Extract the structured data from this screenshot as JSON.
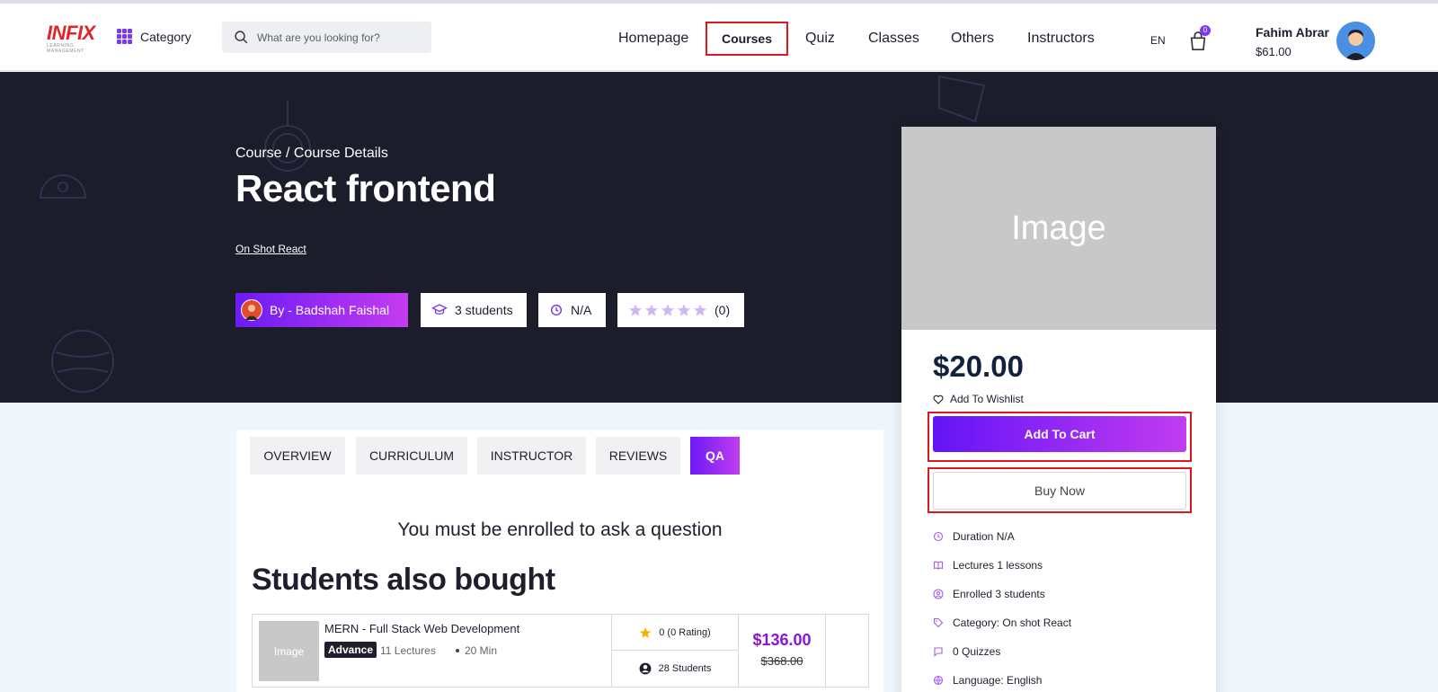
{
  "header": {
    "logo_text": "INFIX",
    "logo_sub": "LEARNING MANAGEMENT",
    "category_label": "Category",
    "search_placeholder": "What are you looking for?",
    "nav": [
      {
        "label": "Homepage"
      },
      {
        "label": "Courses"
      },
      {
        "label": "Quiz"
      },
      {
        "label": "Classes"
      },
      {
        "label": "Others"
      },
      {
        "label": "Instructors"
      }
    ],
    "language": "EN",
    "cart_count": "0",
    "user_name": "Fahim Abrar",
    "user_balance": "$61.00"
  },
  "hero": {
    "breadcrumb": "Course / Course Details",
    "title": "React frontend",
    "category_link": "On Shot React",
    "instructor": "By - Badshah Faishal",
    "students": "3 students",
    "duration": "N/A",
    "rating_count": "(0)",
    "rating_stars": 0
  },
  "card": {
    "image_placeholder": "Image",
    "price": "$20.00",
    "wishlist": "Add To Wishlist",
    "add_to_cart": "Add To Cart",
    "buy_now": "Buy Now",
    "meta": [
      {
        "icon": "clock-icon",
        "text": "Duration N/A"
      },
      {
        "icon": "book-icon",
        "text": "Lectures 1 lessons"
      },
      {
        "icon": "user-icon",
        "text": "Enrolled 3 students"
      },
      {
        "icon": "tag-icon",
        "text": "Category: On shot React"
      },
      {
        "icon": "quiz-icon",
        "text": "0 Quizzes"
      },
      {
        "icon": "globe-icon",
        "text": "Language: English"
      }
    ]
  },
  "tabs": [
    {
      "label": "OVERVIEW"
    },
    {
      "label": "CURRICULUM"
    },
    {
      "label": "INSTRUCTOR"
    },
    {
      "label": "REVIEWS"
    },
    {
      "label": "QA",
      "active": true
    }
  ],
  "qa_notice": "You must be enrolled to ask a question",
  "also_bought": {
    "heading": "Students also bought",
    "items": [
      {
        "image_placeholder": "Image",
        "title": "MERN - Full Stack Web Development",
        "level": "Advance",
        "lectures": "11 Lectures",
        "duration": "20 Min",
        "rating": "0 (0 Rating)",
        "students": "28 Students",
        "price": "$136.00",
        "old_price": "$368.00"
      }
    ]
  },
  "colors": {
    "accent": "#7c3aed",
    "gradient_start": "#6414f7",
    "gradient_end": "#c23cf0",
    "hero_bg": "#1c1d2b",
    "highlight": "#e3141c"
  }
}
